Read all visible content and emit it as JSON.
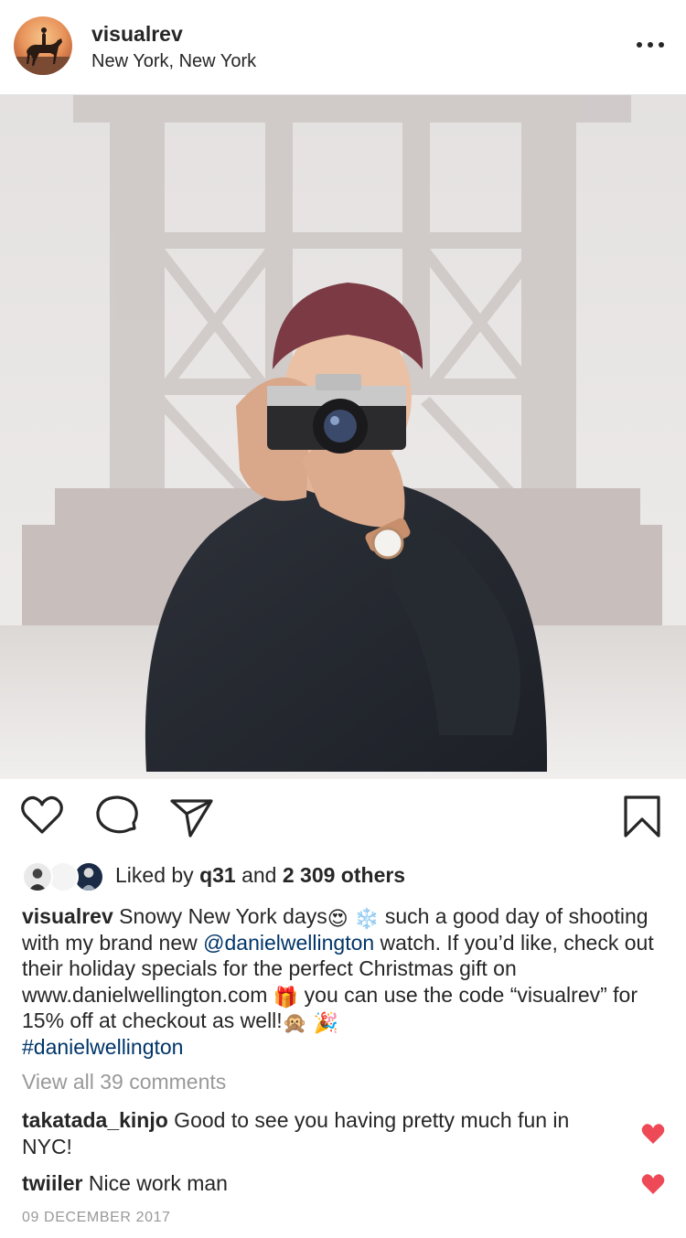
{
  "post": {
    "username": "visualrev",
    "location": "New York, New York",
    "more_icon": "more-horizontal-icon"
  },
  "actions": {
    "icons": [
      "heart-outline-icon",
      "comment-bubble-icon",
      "share-paper-plane-icon",
      "bookmark-icon"
    ]
  },
  "likes": {
    "prefix": "Liked by ",
    "user": "q31",
    "middle": " and ",
    "count": "2 309 others"
  },
  "caption": {
    "username": "visualrev",
    "part1": " Snowy New York days",
    "emoji1": "😍",
    "emoji2": "❄️",
    "part2": " such a good day of shooting with my brand new ",
    "mention": "@danielwellington",
    "part3": " watch. If you’d like, check out their holiday specials for the perfect Christmas gift on www.danielwellington.com ",
    "emoji3": "🎁",
    "part4": " you can use the code “visualrev” for 15% off at checkout as well!",
    "emoji4": "🙊",
    "emoji5": "🎉",
    "hashtag": "#danielwellington"
  },
  "view_all": "View all 39 comments",
  "comments": [
    {
      "user": "takatada_kinjo",
      "text": " Good to see you having pretty much fun in NYC!"
    },
    {
      "user": "twiiler",
      "text": " Nice work man"
    }
  ],
  "date": "09 DECEMBER 2017",
  "colors": {
    "text": "#262626",
    "secondary": "#999999",
    "link": "#003569",
    "like_red": "#ed4956",
    "divider": "#e6e6e6"
  }
}
